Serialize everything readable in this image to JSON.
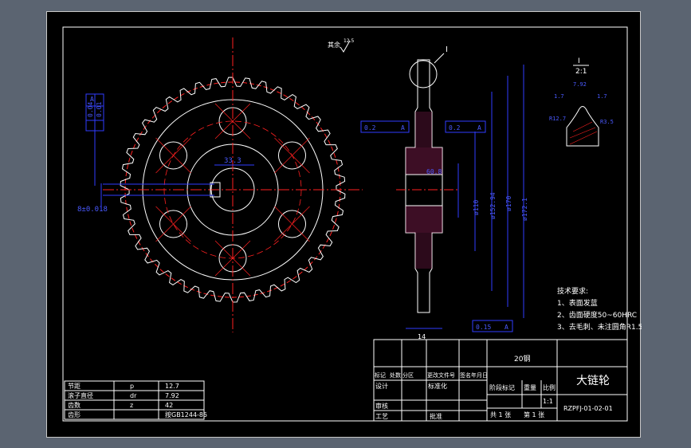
{
  "drawing": {
    "surface_roughness": "其余",
    "roughness_value": "12.5",
    "detail_mark": "I",
    "detail_scale": "2:1",
    "detail_scale_letter": "I",
    "hub_bore_dim": "33.3",
    "key_width_dim": "8±0.018",
    "tol_a1": "0.04",
    "tol_a2": "0.01",
    "tol_a3": "0.2",
    "tol_a4": "0.2",
    "tol_a5": "0.15",
    "datum": "A",
    "hub_width": "14",
    "hub_dia": "60.8",
    "d_110": "ø110",
    "d_152": "ø152.94",
    "d_170": "ø170",
    "d_172": "ø172.1",
    "detail_dims": [
      "7.92",
      "1.7",
      "1.7",
      "R12.7",
      "R3.5"
    ]
  },
  "requirements": {
    "title": "技术要求:",
    "items": [
      "1、表面发蓝",
      "2、齿面硬度50~60HRC",
      "3、去毛刺、未注圆角R1.5"
    ]
  },
  "param_table": {
    "rows": [
      [
        "节距",
        "p",
        "12.7"
      ],
      [
        "滚子直径",
        "dr",
        "7.92"
      ],
      [
        "齿数",
        "z",
        "42"
      ],
      [
        "齿形",
        "",
        "按GB1244-85"
      ]
    ]
  },
  "title_block": {
    "material": "20钢",
    "part_name": "大链轮",
    "drawing_no": "RZPFJ-01-02-01",
    "scale": "1:1",
    "sheets_total": "共 1 张",
    "sheet_no": "第 1 张",
    "headers": [
      "标记",
      "处数",
      "分区",
      "更改文件号",
      "签名",
      "年月日"
    ],
    "design": "设计",
    "standardize": "标准化",
    "check": "审核",
    "process": "工艺",
    "approve": "批准",
    "stage_mark": "阶段标记",
    "weight": "重量",
    "ratio": "比例"
  }
}
